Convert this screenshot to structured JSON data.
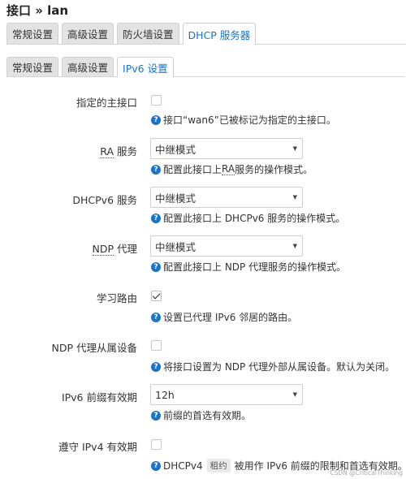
{
  "page": {
    "title": "接口 » lan"
  },
  "top_tabs": [
    {
      "label": "常规设置",
      "active": false
    },
    {
      "label": "高级设置",
      "active": false
    },
    {
      "label": "防火墙设置",
      "active": false
    },
    {
      "label": "DHCP 服务器",
      "active": true
    }
  ],
  "sub_tabs": [
    {
      "label": "常规设置",
      "active": false
    },
    {
      "label": "高级设置",
      "active": false
    },
    {
      "label": "IPv6 设置",
      "active": true
    }
  ],
  "fields": {
    "designated_master": {
      "label": "指定的主接口",
      "checked": false,
      "help": "接口“wan6”已被标记为指定的主接口。"
    },
    "ra_service": {
      "label_abbr": "RA",
      "label_rest": " 服务",
      "value": "中继模式",
      "help_pre": "配置此接口上 ",
      "help_abbr": "RA",
      "help_post": " 服务的操作模式。"
    },
    "dhcpv6_service": {
      "label": "DHCPv6 服务",
      "value": "中继模式",
      "help": "配置此接口上 DHCPv6 服务的操作模式。"
    },
    "ndp_proxy": {
      "label_abbr": "NDP",
      "label_rest": " 代理",
      "value": "中继模式",
      "help": "配置此接口上 NDP 代理服务的操作模式。"
    },
    "learn_routes": {
      "label": "学习路由",
      "checked": true,
      "help": "设置已代理 IPv6 邻居的路由。"
    },
    "ndp_slave": {
      "label": "NDP 代理从属设备",
      "checked": false,
      "help": "将接口设置为 NDP 代理外部从属设备。默认为关闭。"
    },
    "ipv6_prefix_lifetime": {
      "label": "IPv6 前缀有效期",
      "value": "12h",
      "help": "前缀的首选有效期。"
    },
    "follow_ipv4_lifetime": {
      "label": "遵守 IPv4 有效期",
      "checked": false,
      "help_pre": "DHCPv4",
      "help_tag": "租约",
      "help_post": "被用作 IPv6 前缀的限制和首选有效期。"
    }
  },
  "icons": {
    "help": "question-circle-icon",
    "dropdown": "caret-down-icon",
    "check": "check-icon"
  },
  "colors": {
    "accent": "#1a73c8"
  },
  "watermark": "CSDN @CriticalThinking"
}
